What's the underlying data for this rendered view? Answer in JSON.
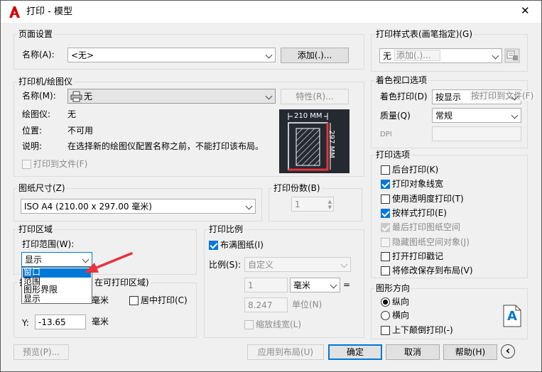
{
  "window": {
    "title": "打印 - 模型",
    "close_glyph": "✕"
  },
  "page_setup": {
    "group": "页面设置",
    "name_label": "名称(A):",
    "name_value": "<无>",
    "add_button": "添加(.)..."
  },
  "printer": {
    "group": "打印机/绘图仪",
    "name_label": "名称(M):",
    "name_value": "无",
    "props_button": "特性(R)...",
    "plotter_label": "绘图仪:",
    "plotter_value": "无",
    "location_label": "位置:",
    "location_value": "不可用",
    "desc_label": "说明:",
    "desc_value": "在选择新的绘图仪配置名称之前，不能打印该布局。",
    "print_to_file": "打印到文件(F)",
    "preview_width": "210 MM",
    "preview_height": "297 MM"
  },
  "paper_size": {
    "group": "图纸尺寸(Z)",
    "value": "ISO A4 (210.00 x 297.00 毫米)"
  },
  "copies": {
    "group": "打印份数(B)",
    "value": "1"
  },
  "print_area": {
    "group": "打印区域",
    "range_label": "打印范围(W):",
    "range_value": "显示",
    "options": [
      "窗口",
      "范围",
      "图形界限",
      "显示"
    ]
  },
  "offset": {
    "group_partial": "在可打印区域)",
    "x_unit": "毫米",
    "center": "居中打印(C)",
    "y_label": "Y:",
    "y_value": "-13.65",
    "y_unit": "毫米"
  },
  "scale": {
    "group": "打印比例",
    "fit": "布满图纸(I)",
    "scale_label": "比例(S):",
    "scale_value": "自定义",
    "val1": "1",
    "unit_value": "毫米",
    "equals": "=",
    "val2": "8.247",
    "units_label": "单位(N)",
    "lineweights": "缩放线宽(L)"
  },
  "style_table": {
    "group": "打印样式表(画笔指定)(G)",
    "value": "无",
    "overlay": "添加(.)..."
  },
  "shaded": {
    "group": "着色视口选项",
    "shade_label": "着色打印(D)",
    "shade_value": "按显示",
    "shade_overlay": "按打印到文件(F)",
    "quality_label": "质量(Q)",
    "quality_value": "常规",
    "dpi_label": "DPI"
  },
  "options": {
    "group": "打印选项",
    "items": [
      {
        "label": "后台打印(K)",
        "checked": false,
        "disabled": false
      },
      {
        "label": "打印对象线宽",
        "checked": true,
        "disabled": false
      },
      {
        "label": "使用透明度打印(T)",
        "checked": false,
        "disabled": false
      },
      {
        "label": "按样式打印(E)",
        "checked": true,
        "disabled": false
      },
      {
        "label": "最后打印图纸空间",
        "checked": true,
        "disabled": true
      },
      {
        "label": "隐藏图纸空间对象(J)",
        "checked": false,
        "disabled": true
      },
      {
        "label": "打开打印戳记",
        "checked": false,
        "disabled": false
      },
      {
        "label": "将修改保存到布局(V)",
        "checked": false,
        "disabled": false
      }
    ]
  },
  "orientation": {
    "group": "图形方向",
    "portrait": "纵向",
    "landscape": "横向",
    "upside_down": "上下颠倒打印(-)",
    "icon_letter": "A"
  },
  "buttons": {
    "preview": "预览(P)...",
    "apply": "应用到布局(U)",
    "ok": "确定",
    "cancel": "取消",
    "help": "帮助(H)",
    "more_glyph": "‹"
  },
  "colors": {
    "accent": "#0078d7",
    "alert_red": "#d40000",
    "arrow_red": "#e8333b",
    "preview_bg": "#252a31"
  }
}
